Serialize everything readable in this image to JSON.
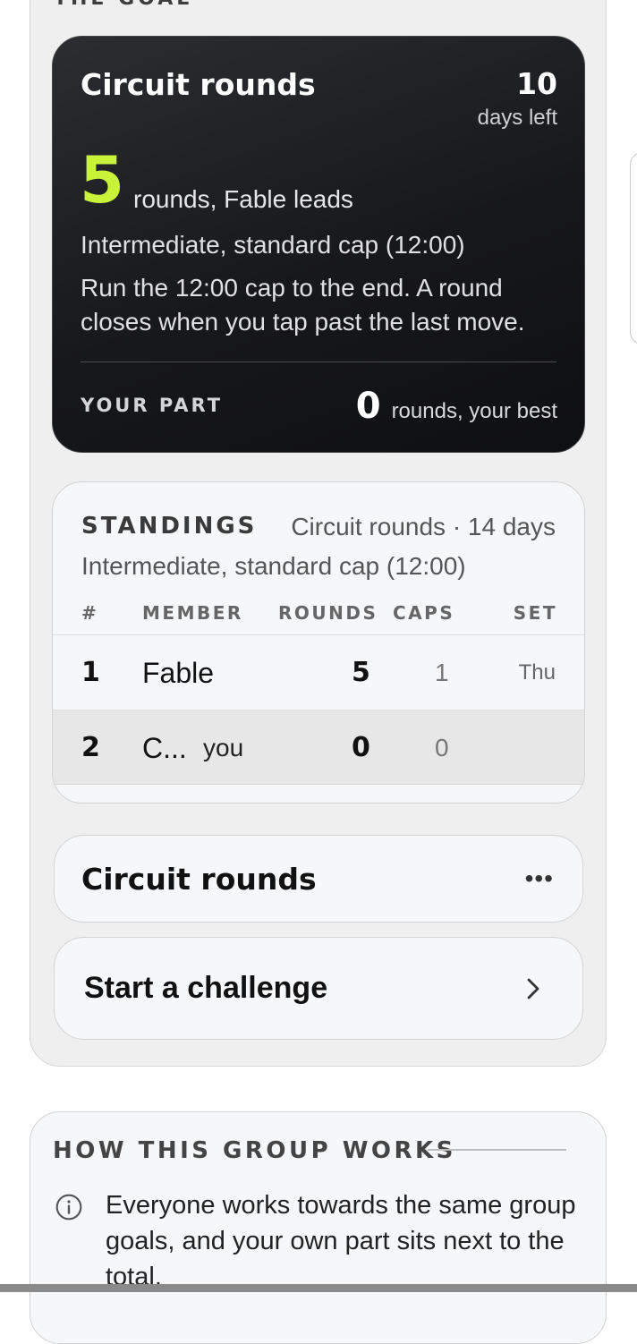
{
  "section_label": "THE GOAL",
  "goal": {
    "title": "Circuit rounds",
    "days_left_value": "10",
    "days_left_label": "days left",
    "count": "5",
    "count_suffix": "rounds, Fable leads",
    "subtitle": "Intermediate, standard cap (12:00)",
    "description": "Run the 12:00 cap to the end. A round closes when you tap past the last move.",
    "your_part_label": "YOUR PART",
    "your_part_value": "0",
    "your_part_suffix": "rounds, your best",
    "accent_color": "#c9f23a"
  },
  "standings": {
    "title": "STANDINGS",
    "meta": "Circuit rounds · 14 days",
    "subtitle": "Intermediate, standard cap (12:00)",
    "columns": [
      "#",
      "MEMBER",
      "ROUNDS",
      "CAPS",
      "SET"
    ],
    "rows": [
      {
        "rank": "1",
        "member": "Fable",
        "you": "",
        "rounds": "5",
        "caps": "1",
        "set": "Thu"
      },
      {
        "rank": "2",
        "member": "C...",
        "you": "you",
        "rounds": "0",
        "caps": "0",
        "set": ""
      }
    ]
  },
  "actions": {
    "challenge_title": "Circuit rounds",
    "more_icon": "ellipsis-icon",
    "start_label": "Start a challenge",
    "chevron_icon": "chevron-right-icon"
  },
  "how": {
    "title": "HOW THIS GROUP WORKS",
    "icon": "info-icon",
    "text": "Everyone works towards the same group goals, and your own part sits next to the total."
  }
}
